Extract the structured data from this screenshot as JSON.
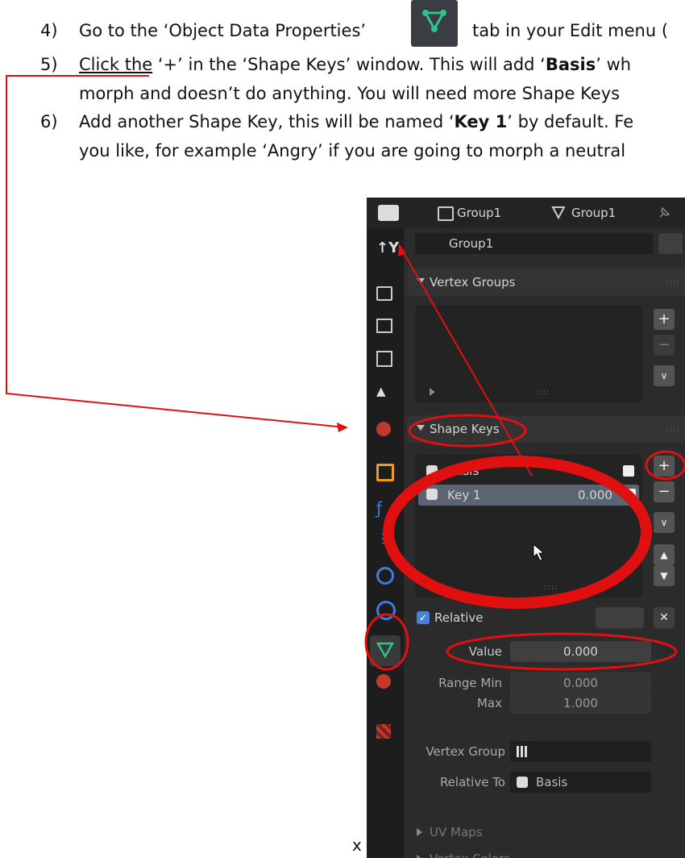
{
  "steps": [
    {
      "num": "4)",
      "text_before": "Go to the ‘Object Data Properties’",
      "text_after": "tab in your Edit menu ("
    },
    {
      "num": "5)",
      "text_underlined": "Click the",
      "text_a": " ‘+’ in the ‘Shape Keys’ window. This will add ‘",
      "bold": "Basis",
      "text_b": "’ wh",
      "continuation": "morph and doesn’t do anything. You will need more Shape Keys"
    },
    {
      "num": "6)",
      "text_a": "Add another Shape Key, this will be named ‘",
      "bold": "Key 1",
      "text_b": "’ by default. Fe",
      "continuation": "you like, for example ‘Angry’ if you are going to morph a neutral"
    }
  ],
  "stray_x": "x",
  "panel": {
    "top": {
      "obj1": "Group1",
      "obj2": "Group1"
    },
    "datablock": "Group1",
    "vertex_groups": {
      "title": "Vertex Groups"
    },
    "shape_keys": {
      "title": "Shape Keys",
      "items": [
        {
          "name": "Basis",
          "value": ""
        },
        {
          "name": "Key 1",
          "value": "0.000"
        }
      ],
      "relative_label": "Relative",
      "value_label": "Value",
      "value": "0.000",
      "range_min_label": "Range Min",
      "range_min": "0.000",
      "max_label": "Max",
      "max": "1.000",
      "vertex_group_label": "Vertex Group",
      "relative_to_label": "Relative To",
      "relative_to": "Basis"
    },
    "uv_maps": "UV Maps",
    "vertex_colors": "Vertex Colors"
  },
  "colors": {
    "annotation_red": "#e01010",
    "panel_bg": "#2b2b2b",
    "accent_green": "#2ec48a"
  }
}
